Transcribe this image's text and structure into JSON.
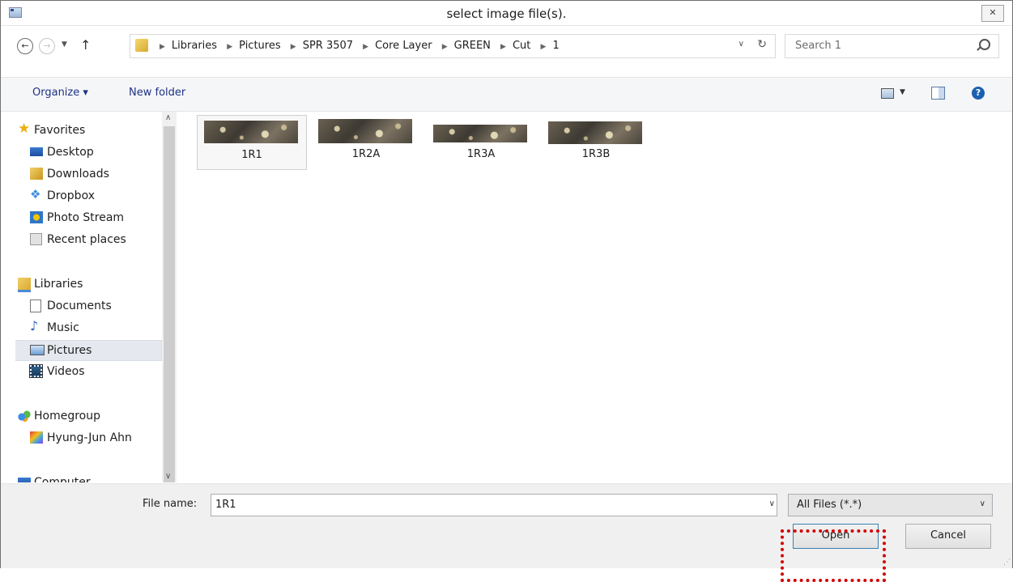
{
  "window": {
    "title": "select image file(s).",
    "close_glyph": "✕"
  },
  "nav": {
    "back_glyph": "←",
    "forward_glyph": "→",
    "breadcrumbs": [
      "Libraries",
      "Pictures",
      "SPR 3507",
      "Core Layer",
      "GREEN",
      "Cut",
      "1"
    ],
    "search_placeholder": "Search 1"
  },
  "toolbar": {
    "organize_label": "Organize ▾",
    "new_folder_label": "New folder"
  },
  "sidebar": {
    "favorites_header": "Favorites",
    "favorites": [
      "Desktop",
      "Downloads",
      "Dropbox",
      "Photo Stream",
      "Recent places"
    ],
    "libraries_header": "Libraries",
    "libraries": [
      "Documents",
      "Music",
      "Pictures",
      "Videos"
    ],
    "selected": "Pictures",
    "homegroup_header": "Homegroup",
    "homegroup_user": "Hyung-Jun Ahn",
    "computer_header": "Computer"
  },
  "files": [
    {
      "name": "1R1",
      "selected": true
    },
    {
      "name": "1R2A",
      "selected": false
    },
    {
      "name": "1R3A",
      "selected": false
    },
    {
      "name": "1R3B",
      "selected": false
    }
  ],
  "bottom": {
    "file_name_label": "File name:",
    "file_name_value": "1R1",
    "file_type_value": "All Files (*.*)",
    "open_label": "Open",
    "cancel_label": "Cancel"
  },
  "colors": {
    "highlight": "#d40000",
    "link_blue": "#1e3287",
    "selection": "#e5e9ef"
  }
}
